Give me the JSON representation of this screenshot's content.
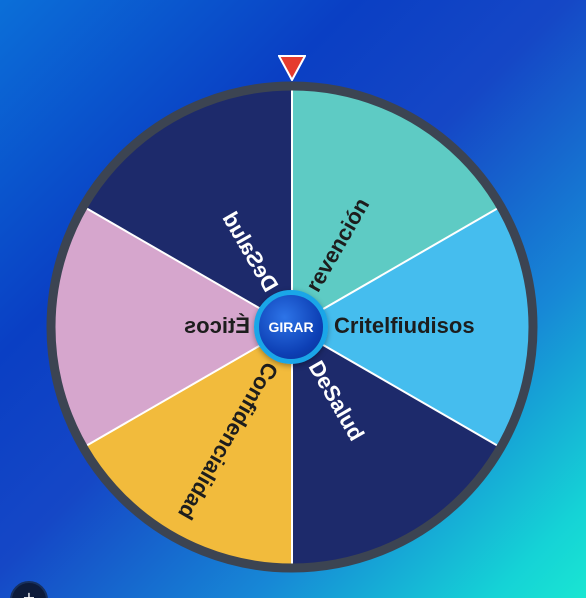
{
  "wheel": {
    "spin_label": "GIRAR",
    "segments": [
      {
        "label": "revención",
        "color": "#5ecbc4",
        "text_color": "#1d1d1d",
        "glyph_mirrored": false
      },
      {
        "label": "Critelfiudisos",
        "color": "#45bdee",
        "text_color": "#1d1d1d",
        "glyph_mirrored": false
      },
      {
        "label": "DeSalud",
        "color": "#1d2a6b",
        "text_color": "#ffffff",
        "glyph_mirrored": false
      },
      {
        "label": "Confidencialidad",
        "color": "#f2bb3c",
        "text_color": "#1d1d1d",
        "glyph_mirrored": false
      },
      {
        "label": "Éticos",
        "color": "#d6a6cd",
        "text_color": "#1d1d1d",
        "glyph_mirrored": true
      },
      {
        "label": "DeSalud",
        "color": "#1d2a6b",
        "text_color": "#ffffff",
        "glyph_mirrored": true
      }
    ],
    "rim_color": "#3c4452",
    "divider_color": "#ffffff",
    "pointer_color": "#e53b2d"
  },
  "corner_button": {
    "glyph": "+"
  }
}
